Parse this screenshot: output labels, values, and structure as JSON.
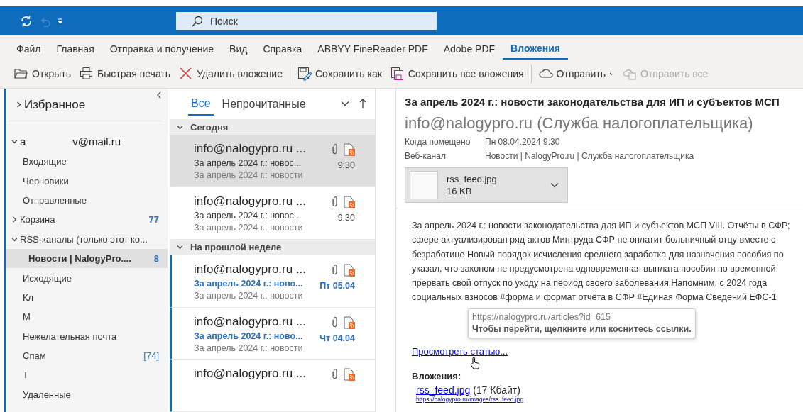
{
  "title_bar": {
    "search": {
      "placeholder": "Поиск"
    }
  },
  "ribbon_tabs": [
    {
      "label": "Файл",
      "selected": false
    },
    {
      "label": "Главная",
      "selected": false
    },
    {
      "label": "Отправка и получение",
      "selected": false
    },
    {
      "label": "Вид",
      "selected": false
    },
    {
      "label": "Справка",
      "selected": false
    },
    {
      "label": "ABBYY FineReader PDF",
      "selected": false
    },
    {
      "label": "Adobe PDF",
      "selected": false
    },
    {
      "label": "Вложения",
      "selected": true
    }
  ],
  "toolbar": [
    {
      "kind": "open",
      "label": "Открыть",
      "disabled": false
    },
    {
      "kind": "print",
      "label": "Быстрая печать",
      "disabled": false
    },
    {
      "kind": "delete",
      "label": "Удалить вложение",
      "disabled": false
    },
    {
      "kind": "separator"
    },
    {
      "kind": "saveas",
      "label": "Сохранить как",
      "disabled": false
    },
    {
      "kind": "saveall",
      "label": "Сохранить все вложения",
      "disabled": false
    },
    {
      "kind": "separator"
    },
    {
      "kind": "send",
      "label": "Отправить",
      "disabled": false,
      "dropdown": true
    },
    {
      "kind": "sendall",
      "label": "Отправить все",
      "disabled": true
    }
  ],
  "sidebar": {
    "favorites": {
      "label": "Избранное",
      "expanded": false
    },
    "account": {
      "label_start": "a",
      "label_end": "v@mail.ru",
      "expanded": true
    },
    "folders": [
      {
        "label": "Входящие",
        "selected": false
      },
      {
        "label": "Черновики",
        "selected": false
      },
      {
        "label": "Отправленные",
        "selected": false
      },
      {
        "label": "Корзина",
        "selected": false,
        "expanded": false,
        "count": "77",
        "count_bold": true
      },
      {
        "label": "RSS-каналы (только этот ко...",
        "selected": false,
        "expanded": true,
        "children": [
          {
            "label": "Новости | NalogyPro....",
            "selected": true,
            "count": "8",
            "count_bold": true
          }
        ]
      },
      {
        "label": "Исходящие",
        "selected": false
      },
      {
        "label": "Кл",
        "selected": false
      },
      {
        "label": "М",
        "selected": false
      },
      {
        "label": "Нежелательная почта",
        "selected": false
      },
      {
        "label": "Спам",
        "selected": false,
        "count": "[74]",
        "count_bold": false
      },
      {
        "label": "Т",
        "selected": false
      },
      {
        "label": "Удаленные",
        "selected": false
      }
    ]
  },
  "message_list": {
    "filters": [
      {
        "label": "Все",
        "selected": true
      },
      {
        "label": "Непрочитанные",
        "selected": false
      }
    ],
    "groups": [
      {
        "label": "Сегодня",
        "expanded": true,
        "messages": [
          {
            "sender": "info@nalogypro.ru ...",
            "subject": "За апрель 2024 г.: новос...",
            "preview": "За апрель 2024 г.: новости",
            "time": "9:30",
            "selected": true,
            "unread": false
          },
          {
            "sender": "info@nalogypro.ru ...",
            "subject": "За апрель 2024 г.: новос...",
            "preview": "За апрель 2024 г.: новости",
            "time": "9:30",
            "selected": false,
            "unread": false
          }
        ]
      },
      {
        "label": "На прошлой неделе",
        "expanded": true,
        "messages": [
          {
            "sender": "info@nalogypro.ru ...",
            "subject": "За апрель 2024 г.: ново...",
            "preview": "За апрель 2024 г.: новости",
            "time": "Пт 05.04",
            "selected": false,
            "unread": true
          },
          {
            "sender": "info@nalogypro.ru ...",
            "subject": "За апрель 2024 г.: ново...",
            "preview": "За апрель 2024 г.: новости",
            "time": "Чт 04.04",
            "selected": false,
            "unread": true
          },
          {
            "sender": "info@nalogypro.ru ...",
            "selected": false,
            "unread": true
          }
        ]
      }
    ]
  },
  "reading_pane": {
    "subject": "За апрель 2024 г.: новости законодательства для ИП и субъектов МСП",
    "from": "info@nalogypro.ru (Служба налогоплательщика)",
    "fields": [
      {
        "label": "Когда помещено",
        "value": "Пн 08.04.2024 9:30"
      },
      {
        "label": "Веб-канал",
        "value": "Новости | NalogyPro.ru | Служба налогоплательщика"
      }
    ],
    "attachment": {
      "name": "rss_feed.jpg",
      "size": "16 KB"
    },
    "body_lines": [
      "За апрель 2024 г.: новости законодательства для ИП и субъектов МСП VIII. Отчёты в СФР;",
      "сфере актуализирован ряд актов Минтруда СФР не оплатит больничный отцу вместе с",
      "безработице Новый порядок исчисления среднего заработка для назначения пособия по",
      "указал, что законом не предусмотрена одновременная выплата пособия по временной",
      "прервать свой отпуск по уходу на период своего заболевания.Напомним, с 2024 года",
      "социальных взносов #форма и формат отчёта в СФР #Единая Форма Сведений ЕФС-1"
    ],
    "tooltip": {
      "url": "https://nalogypro.ru/articles?id=615",
      "hint": "Чтобы перейти, щелкните или коснитесь ссылки."
    },
    "article_link": "Просмотреть статью...",
    "attachments_heading": "Вложения:",
    "attachment_link": {
      "name": "rss_feed.jpg",
      "size": "(17 Кбайт)",
      "url": "https://nalogypro.ru/images/rss_feed.jpg"
    }
  }
}
